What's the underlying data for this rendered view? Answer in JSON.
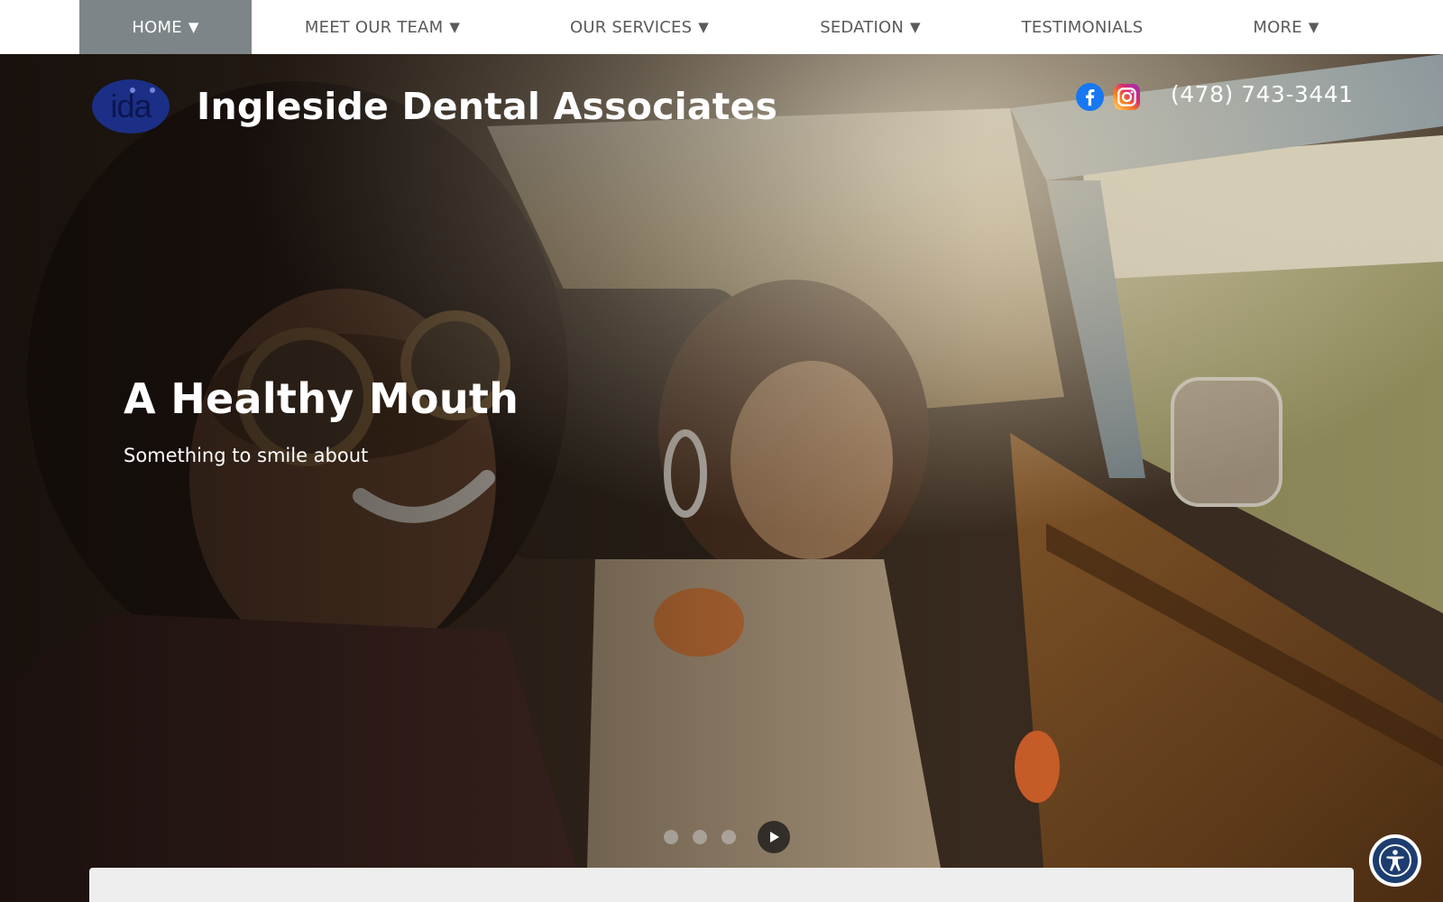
{
  "nav": {
    "items": [
      {
        "label": "HOME",
        "caret": "▼",
        "active": true
      },
      {
        "label": "MEET OUR TEAM",
        "caret": "▼"
      },
      {
        "label": "OUR SERVICES",
        "caret": "▼"
      },
      {
        "label": "SEDATION",
        "caret": "▼"
      },
      {
        "label": "TESTIMONIALS",
        "caret": ""
      },
      {
        "label": "MORE",
        "caret": "▼"
      }
    ]
  },
  "header": {
    "logo_text": "ida",
    "site_name": "Ingleside Dental Associates",
    "phone": "(478) 743-3441",
    "social": [
      "facebook-icon",
      "instagram-icon"
    ]
  },
  "hero": {
    "headline": "A Healthy Mouth",
    "subheadline": "Something to smile about",
    "slides": 3,
    "play_icon": "play-icon"
  },
  "colors": {
    "nav_active_bg": "#7d8588",
    "nav_text": "#5a5a5a",
    "logo_bg": "#1b2f86",
    "accessibility_bg": "#1d3d70"
  }
}
